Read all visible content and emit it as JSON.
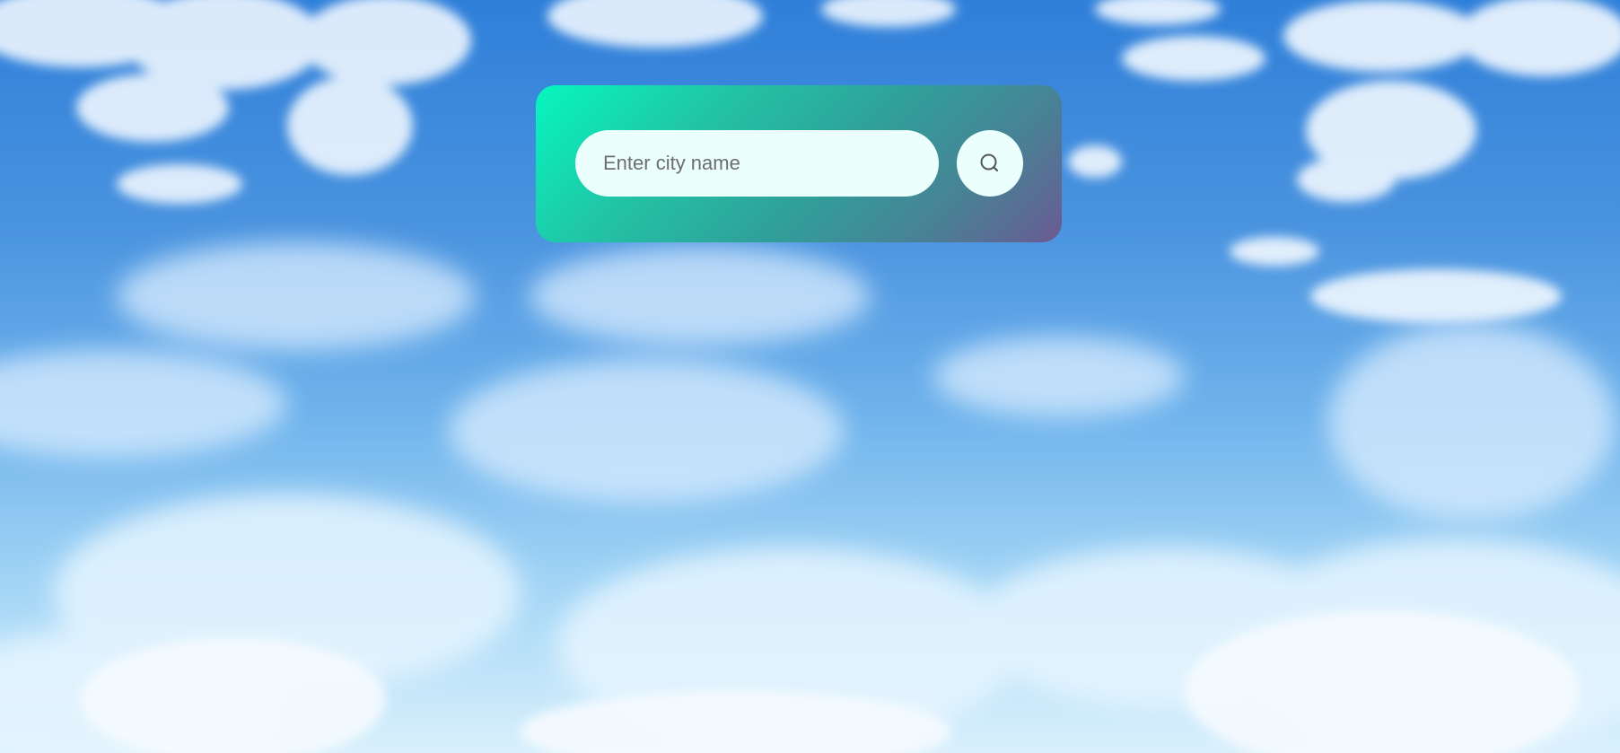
{
  "search": {
    "placeholder": "Enter city name",
    "value": "",
    "button_icon": "search-icon"
  },
  "theme": {
    "card_gradient_start": "#06f7c0",
    "card_gradient_end": "#6b5a92",
    "field_background": "#ebfffd",
    "sky_top": "#2f7fd9",
    "sky_bottom": "#d9f0fc"
  }
}
